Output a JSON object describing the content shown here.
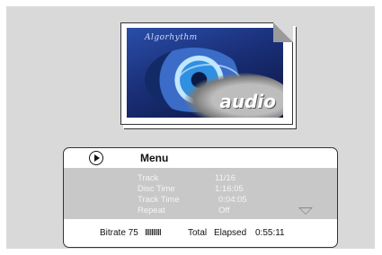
{
  "album": {
    "script_text": "Algorhythm",
    "label": "audio"
  },
  "menu": {
    "title": "Menu",
    "rows": [
      {
        "label": "Track",
        "value": "11/16"
      },
      {
        "label": "Disc Time",
        "value": "1:16:05"
      },
      {
        "label": "Track Time",
        "value": "0:04:05"
      },
      {
        "label": "Repeat",
        "value": "Off"
      }
    ]
  },
  "status": {
    "bitrate_label": "Bitrate 75",
    "bitrate_bars": "IIIIIIIIII",
    "mode": "Total",
    "elapsed_label": "Elapsed",
    "elapsed_value": "0:55:11"
  },
  "icons": {
    "play": "play-icon",
    "scroll_down": "triangle-down-icon"
  }
}
